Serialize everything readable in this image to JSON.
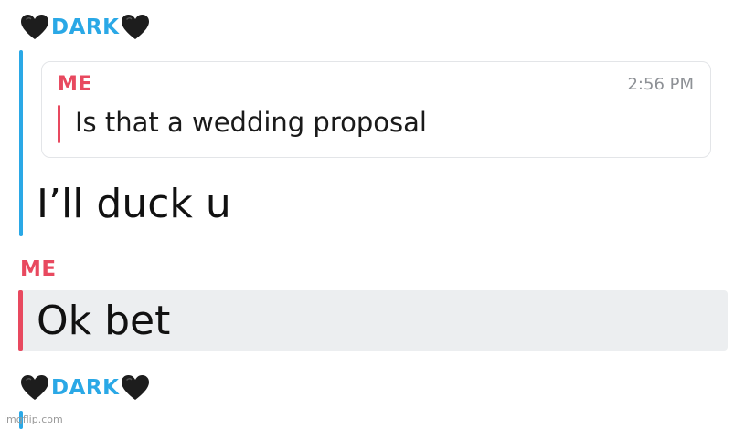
{
  "messages": [
    {
      "sender": "DARK",
      "sender_color": "#2aa8e6",
      "icon": "black-heart-icon"
    },
    {
      "quote": {
        "sender": "ME",
        "time": "2:56 PM",
        "text": "Is that a wedding proposal"
      },
      "text": "I’ll duck u"
    },
    {
      "sender": "ME",
      "sender_color": "#e8495f",
      "text": "Ok bet"
    },
    {
      "sender": "DARK",
      "sender_color": "#2aa8e6",
      "icon": "black-heart-icon"
    }
  ],
  "watermark": "imgflip.com"
}
